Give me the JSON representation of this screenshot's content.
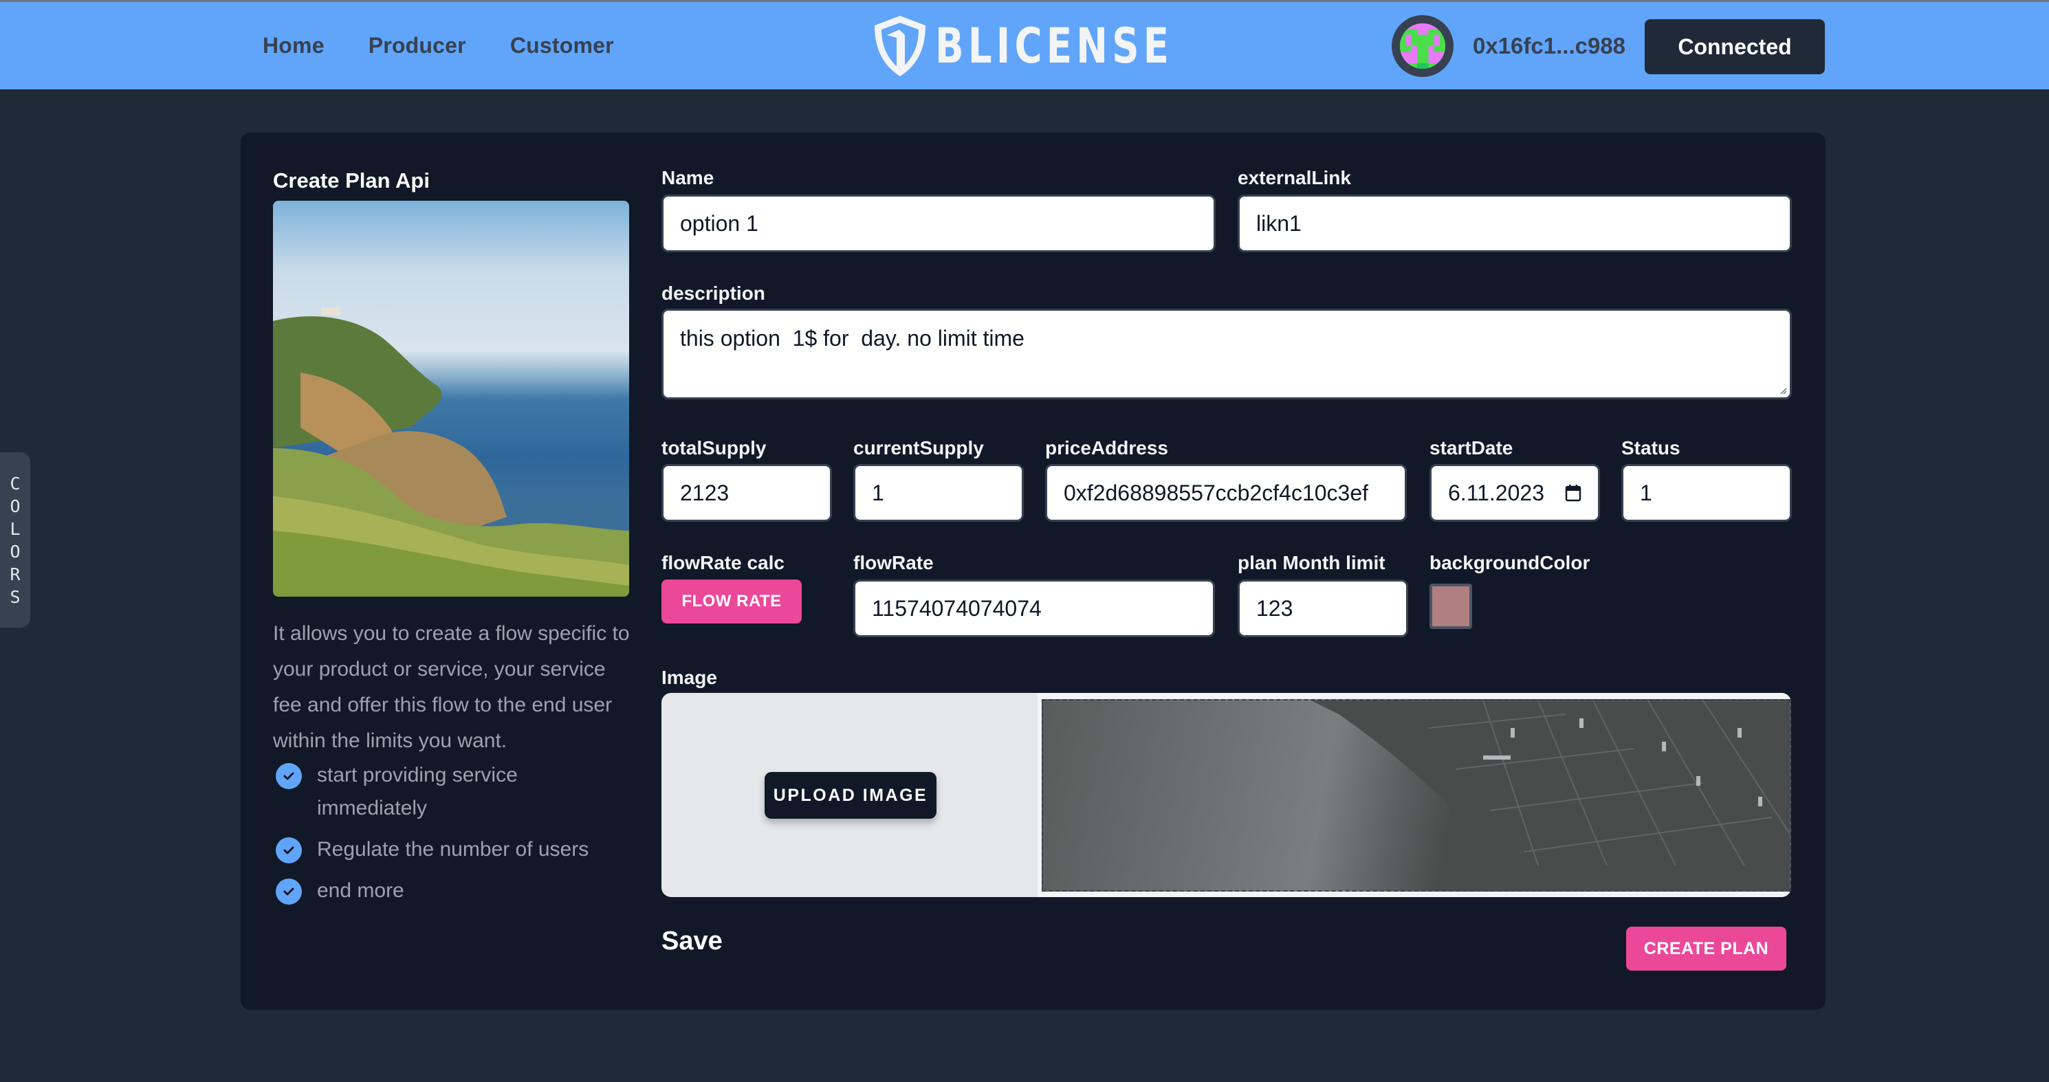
{
  "header": {
    "nav": [
      "Home",
      "Producer",
      "Customer"
    ],
    "logo_text": "BLICENSE",
    "account_address": "0x16fc1...c988",
    "connect_status": "Connected"
  },
  "colors_tab": [
    "C",
    "O",
    "L",
    "O",
    "R",
    "S"
  ],
  "left_panel": {
    "title": "Create Plan Api",
    "description": "It allows you to create a flow specific to your product or service, your service fee and offer this flow to the end user within the limits you want.",
    "features": [
      "start providing service immediately",
      "Regulate the number of users",
      "end more"
    ]
  },
  "form": {
    "name": {
      "label": "Name",
      "value": "option 1"
    },
    "external_link": {
      "label": "externalLink",
      "value": "likn1"
    },
    "description": {
      "label": "description",
      "value": "this option  1$ for  day. no limit time"
    },
    "total_supply": {
      "label": "totalSupply",
      "value": "2123"
    },
    "current_supply": {
      "label": "currentSupply",
      "value": "1"
    },
    "price_address": {
      "label": "priceAddress",
      "value": "0xf2d68898557ccb2cf4c10c3ef"
    },
    "start_date": {
      "label": "startDate",
      "value": "6.11.2023"
    },
    "status": {
      "label": "Status",
      "value": "1"
    },
    "flow_rate_calc": {
      "label": "flowRate calc",
      "button": "FLOW RATE"
    },
    "flow_rate": {
      "label": "flowRate",
      "value": "11574074074074"
    },
    "plan_month_limit": {
      "label": "plan Month limit",
      "value": "123"
    },
    "background_color": {
      "label": "backgroundColor",
      "value": "#b08080"
    },
    "image": {
      "label": "Image",
      "upload_button": "UPLOAD IMAGE"
    },
    "save_title": "Save",
    "create_button": "CREATE PLAN"
  },
  "colors": {
    "header_bg": "#60a5fa",
    "page_bg": "#1f2937",
    "card_bg": "#111827",
    "accent_pink": "#ec4899",
    "check_blue": "#60a5fa"
  }
}
